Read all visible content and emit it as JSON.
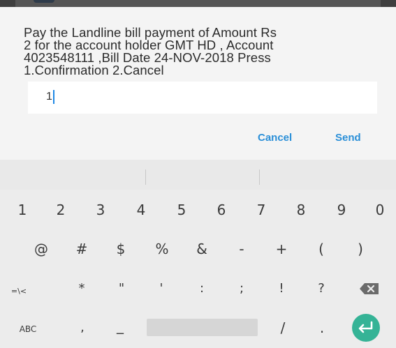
{
  "dialog": {
    "message": "Pay the Landline bill payment of Amount Rs\n2 for the account holder GMT HD   , Account\n4023548111 ,Bill Date  24-NOV-2018 Press\n1.Confirmation 2.Cancel",
    "input_value": "1",
    "cancel_label": "Cancel",
    "send_label": "Send",
    "accent_color": "#2a8fd8"
  },
  "keyboard": {
    "row1": [
      "1",
      "2",
      "3",
      "4",
      "5",
      "6",
      "7",
      "8",
      "9",
      "0"
    ],
    "row2": [
      "@",
      "#",
      "$",
      "%",
      "&",
      "-",
      "+",
      "(",
      ")"
    ],
    "row3": [
      "=\\<",
      "*",
      "\"",
      "'",
      ":",
      ";",
      "!",
      "?"
    ],
    "row4": {
      "abc_label": "ABC",
      "comma": ",",
      "underscore": "_",
      "slash": "/",
      "period": "."
    },
    "delete_icon": "backspace-icon",
    "enter_icon": "enter-icon",
    "enter_color": "#35b396"
  }
}
